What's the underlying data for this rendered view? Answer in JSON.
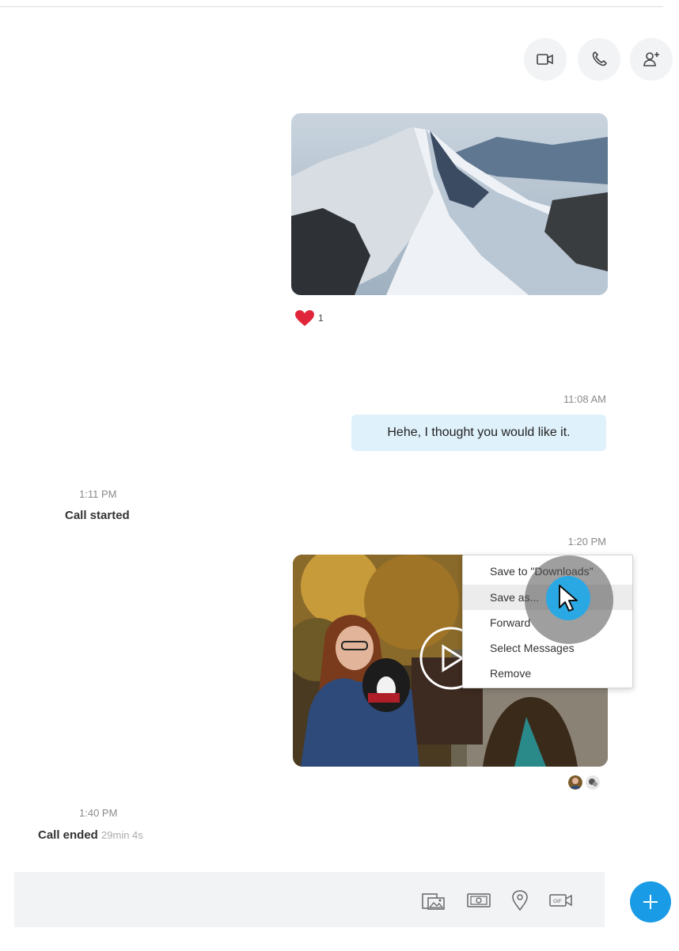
{
  "header": {
    "actions": [
      {
        "icon": "video-call-icon"
      },
      {
        "icon": "phone-call-icon"
      },
      {
        "icon": "add-person-icon"
      }
    ]
  },
  "messages": {
    "photo1": {
      "alt": "snowy mountain ridge photo",
      "reaction_count": "1"
    },
    "text_message": {
      "time": "11:08 AM",
      "text": "Hehe, I thought you would like it."
    },
    "call_started": {
      "time": "1:11 PM",
      "text": "Call started"
    },
    "photo2": {
      "time": "1:20 PM"
    },
    "call_ended": {
      "time": "1:40 PM",
      "text": "Call ended",
      "duration": "29min 4s"
    }
  },
  "context_menu": {
    "items": [
      {
        "label": "Save to \"Downloads\""
      },
      {
        "label": "Save as..."
      },
      {
        "label": "Forward"
      },
      {
        "label": "Select Messages"
      },
      {
        "label": "Remove"
      }
    ]
  },
  "composer": {
    "icons": [
      "media-gallery-icon",
      "send-money-icon",
      "location-pin-icon",
      "gif-icon"
    ]
  },
  "colors": {
    "accent": "#1a9be6",
    "bubble": "#dff1fb",
    "reaction": "#e0263a"
  }
}
